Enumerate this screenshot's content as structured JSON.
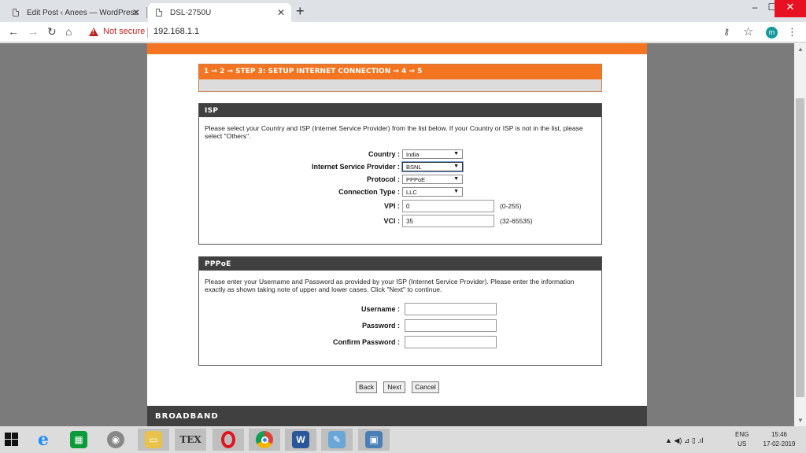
{
  "browser": {
    "tabs": [
      {
        "title": "Edit Post ‹ Anees — WordPress",
        "close": "✕"
      },
      {
        "title": "DSL-2750U",
        "close": "✕"
      }
    ],
    "new_tab": "+",
    "security_label": "Not secure",
    "url": "192.168.1.1",
    "avatar_letter": "m"
  },
  "wizard": {
    "step_header": "1 → 2 → STEP 3: SETUP INTERNET CONNECTION → 4 → 5"
  },
  "isp_panel": {
    "title": "ISP",
    "description": "Please select your Country and ISP (Internet Service Provider) from the list below. If your Country or ISP is not in the list, please select \"Others\".",
    "country": {
      "label": "Country :",
      "value": "India"
    },
    "isp": {
      "label": "Internet Service Provider :",
      "value": "BSNL"
    },
    "protocol": {
      "label": "Protocol :",
      "value": "PPPoE"
    },
    "connection_type": {
      "label": "Connection Type :",
      "value": "LLC"
    },
    "vpi": {
      "label": "VPI :",
      "value": "0",
      "range": "(0-255)"
    },
    "vci": {
      "label": "VCI :",
      "value": "35",
      "range": "(32-65535)"
    }
  },
  "pppoe_panel": {
    "title": "PPPoE",
    "description": "Please enter your Username and Password as provided by your ISP (Internet Service Provider). Please enter the information exactly as shown taking note of upper and lower cases. Click \"Next\" to continue.",
    "username": {
      "label": "Username :",
      "value": ""
    },
    "password": {
      "label": "Password :",
      "value": ""
    },
    "confirm_password": {
      "label": "Confirm Password :",
      "value": ""
    }
  },
  "buttons": {
    "back": "Back",
    "next": "Next",
    "cancel": "Cancel"
  },
  "footer": {
    "brand": "BROADBAND"
  },
  "taskbar": {
    "language": "ENG",
    "region": "US",
    "time": "15:46",
    "date": "17-02-2019"
  },
  "colors": {
    "accent": "#f47521",
    "panel_header": "#404040",
    "page_bg": "#7b7b7b"
  }
}
